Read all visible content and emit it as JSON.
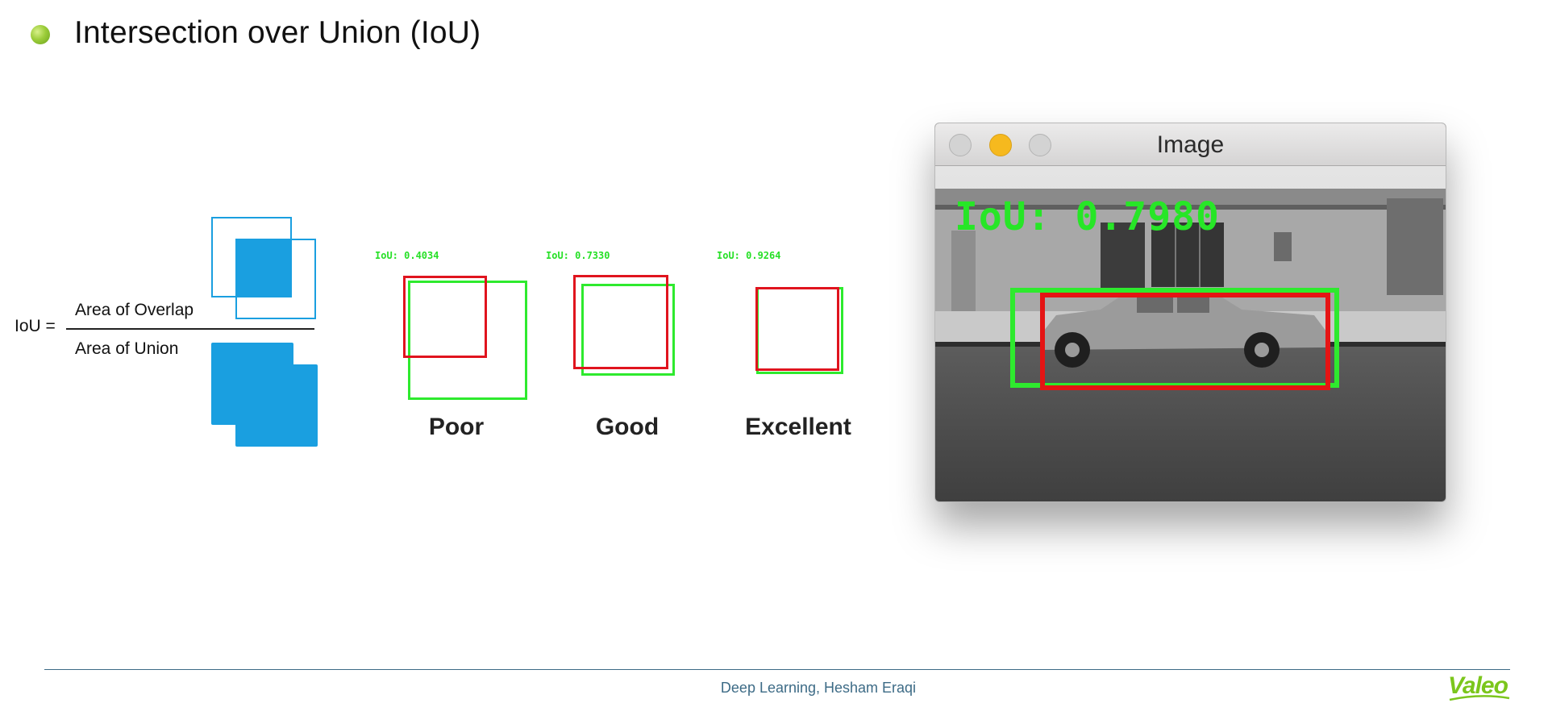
{
  "slide": {
    "title": "Intersection over Union (IoU)"
  },
  "formula": {
    "lhs": "IoU =",
    "numerator": "Area of Overlap",
    "denominator": "Area of Union"
  },
  "examples": [
    {
      "iou": "IoU: 0.4034",
      "label": "Poor"
    },
    {
      "iou": "IoU: 0.7330",
      "label": "Good"
    },
    {
      "iou": "IoU: 0.9264",
      "label": "Excellent"
    }
  ],
  "window": {
    "title": "Image",
    "iou_readout": "IoU: 0.7980"
  },
  "footer": {
    "text": "Deep Learning, Hesham Eraqi",
    "logo": "Valeo"
  },
  "colors": {
    "accent_blue": "#1a9fe0",
    "ground_truth_green": "#2eea2e",
    "prediction_red": "#e0141e",
    "bullet_green": "#9ccd3a",
    "footer_blue": "#3d6b86",
    "brand_green": "#7bc61c"
  }
}
